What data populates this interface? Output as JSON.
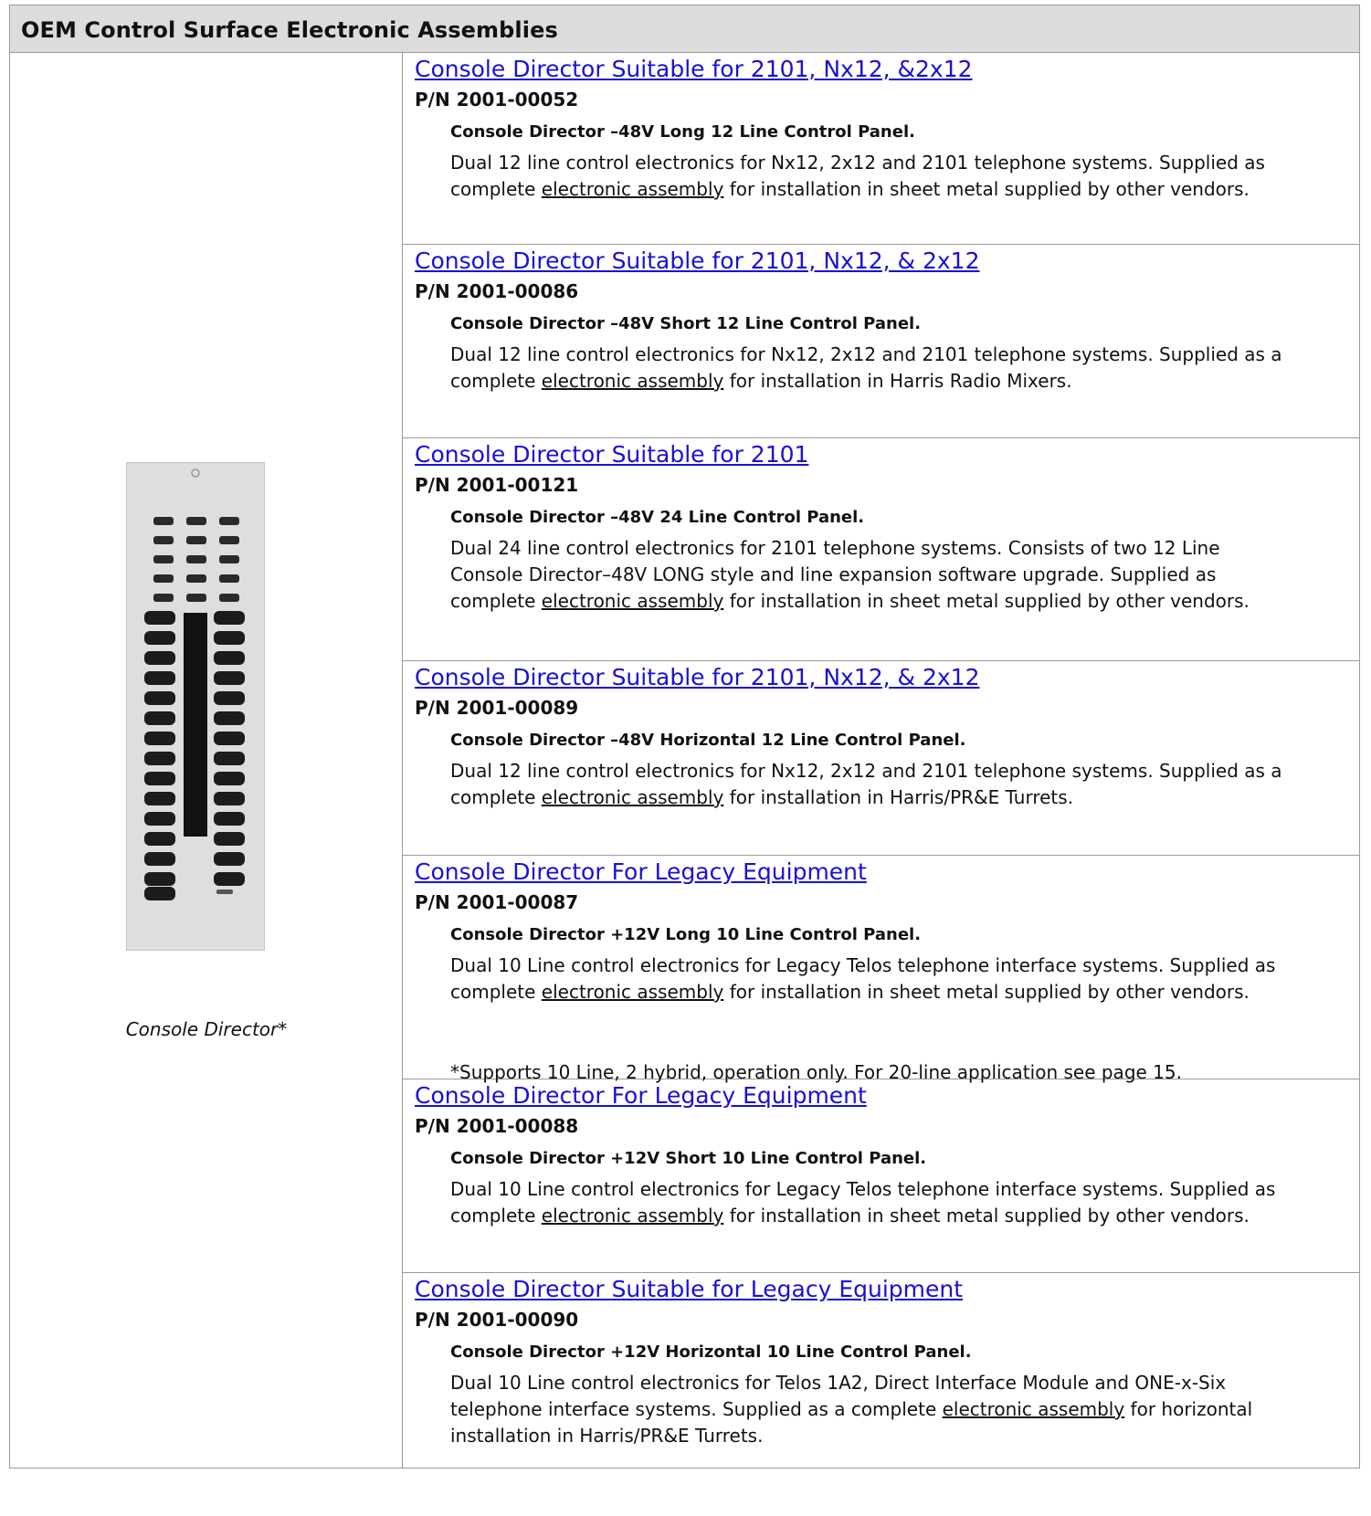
{
  "header": {
    "title": "OEM Control Surface Electronic Assemblies"
  },
  "sidebar": {
    "caption": "Console Director*"
  },
  "entries": [
    {
      "title": "Console Director Suitable for 2101, Nx12, &2x12",
      "part_number": "P/N 2001-00052",
      "subtitle": "Console Director  –48V Long 12 Line Control Panel.",
      "desc_before": "Dual 12 line control electronics for Nx12, 2x12 and 2101 telephone systems. Supplied as complete ",
      "desc_link": "electronic assembly",
      "desc_after": " for installation in sheet metal supplied by other vendors.",
      "note": ""
    },
    {
      "title": "Console Director Suitable for 2101, Nx12, & 2x12",
      "part_number": "P/N 2001-00086",
      "subtitle": "Console Director  –48V Short 12 Line Control Panel.",
      "desc_before": "Dual 12 line control electronics for Nx12, 2x12 and 2101 telephone systems. Supplied as a complete ",
      "desc_link": "electronic assembly",
      "desc_after": " for installation in Harris Radio Mixers.",
      "note": ""
    },
    {
      "title": "Console Director Suitable for 2101",
      "part_number": "P/N 2001-00121",
      "subtitle": "Console Director  –48V 24 Line Control Panel.",
      "desc_before": "Dual 24 line control electronics for 2101 telephone systems. Consists of two 12 Line Console Director–48V LONG style and  line expansion software upgrade. Supplied as complete ",
      "desc_link": "electronic assembly",
      "desc_after": " for installation in sheet metal supplied by other vendors.",
      "note": ""
    },
    {
      "title": "Console Director Suitable for 2101, Nx12, & 2x12",
      "part_number": "P/N 2001-00089",
      "subtitle": "Console Director  –48V Horizontal 12 Line Control Panel.",
      "desc_before": "Dual 12 line control electronics for Nx12, 2x12 and 2101 telephone systems. Supplied as a complete ",
      "desc_link": "electronic assembly",
      "desc_after": " for installation in Harris/PR&E Turrets.",
      "note": ""
    },
    {
      "title": "Console Director For Legacy Equipment",
      "part_number": "P/N 2001-00087",
      "subtitle": "Console Director +12V Long 10 Line Control Panel.",
      "desc_before": "Dual 10 Line control electronics for Legacy Telos telephone interface systems. Supplied as complete ",
      "desc_link": "electronic assembly",
      "desc_after": " for installation in sheet metal supplied by other vendors.",
      "note": "*Supports 10 Line, 2 hybrid, operation only. For 20-line application see page 15."
    },
    {
      "title": "Console Director For Legacy Equipment",
      "part_number": "P/N 2001-00088",
      "subtitle": "Console Director +12V Short 10 Line Control Panel.",
      "desc_before": "Dual 10 Line control electronics for Legacy Telos telephone interface systems. Supplied as complete ",
      "desc_link": "electronic assembly",
      "desc_after": " for installation in sheet metal supplied by other vendors.",
      "note": ""
    },
    {
      "title": "Console Director Suitable for Legacy Equipment",
      "part_number": "P/N 2001-00090",
      "subtitle": "Console Director  +12V Horizontal 10 Line Control Panel.",
      "desc_before": "Dual 10 Line control electronics for Telos 1A2, Direct Interface Module and ONE-x-Six telephone interface systems.  Supplied as a complete ",
      "desc_link": "electronic assembly",
      "desc_after": " for horizontal installation in Harris/PR&E Turrets.",
      "note": ""
    }
  ]
}
